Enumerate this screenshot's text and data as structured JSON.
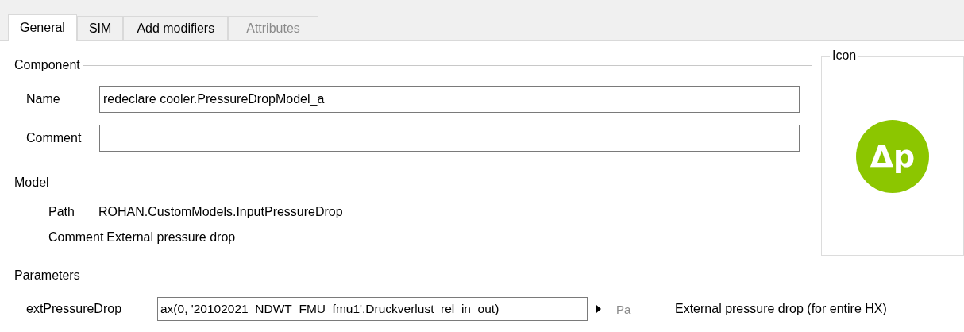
{
  "tabs": [
    {
      "label": "General",
      "selected": true,
      "disabled": false
    },
    {
      "label": "SIM",
      "selected": false,
      "disabled": false
    },
    {
      "label": "Add modifiers",
      "selected": false,
      "disabled": false
    },
    {
      "label": "Attributes",
      "selected": false,
      "disabled": true
    }
  ],
  "component": {
    "title": "Component",
    "fields": [
      {
        "label": "Name",
        "value": "redeclare cooler.PressureDropModel_a"
      },
      {
        "label": "Comment"
      }
    ]
  },
  "model": {
    "title": "Model",
    "rows": [
      {
        "label": "Path",
        "value": "ROHAN.CustomModels.InputPressureDrop"
      },
      {
        "label": "Comment",
        "value": "External pressure drop"
      }
    ]
  },
  "icon": {
    "title": "Icon",
    "symbol": "Δp"
  },
  "parameters": {
    "title": "Parameters",
    "rows": [
      {
        "name": "extPressureDrop",
        "value": "ax(0, '20102021_NDWT_FMU_fmu1'.Druckverlust_rel_in_out)",
        "unit": "Pa",
        "description": "External pressure drop (for entire HX)"
      }
    ]
  }
}
